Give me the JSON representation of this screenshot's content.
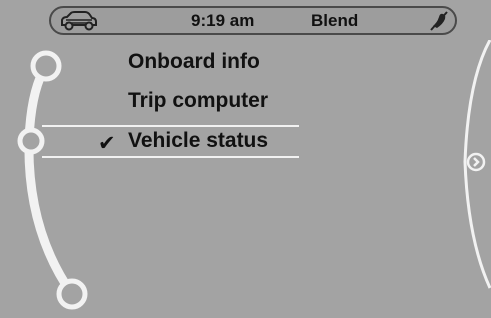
{
  "status_bar": {
    "car_icon": "car-icon",
    "clock": "9:19  am",
    "audio_source": "Blend",
    "mute_icon": "mute-icon"
  },
  "menu": {
    "items": [
      {
        "label": "Onboard info",
        "selected": false
      },
      {
        "label": "Trip computer",
        "selected": false
      },
      {
        "label": "Vehicle status",
        "selected": true
      }
    ],
    "selected_marker_icon": "checkmark-icon"
  },
  "right_panel": {
    "arrow_icon": "chevron-right-icon"
  },
  "colors": {
    "screen_background": "#a3a3a3",
    "rail": "#f2f2f2",
    "text": "#111111"
  }
}
